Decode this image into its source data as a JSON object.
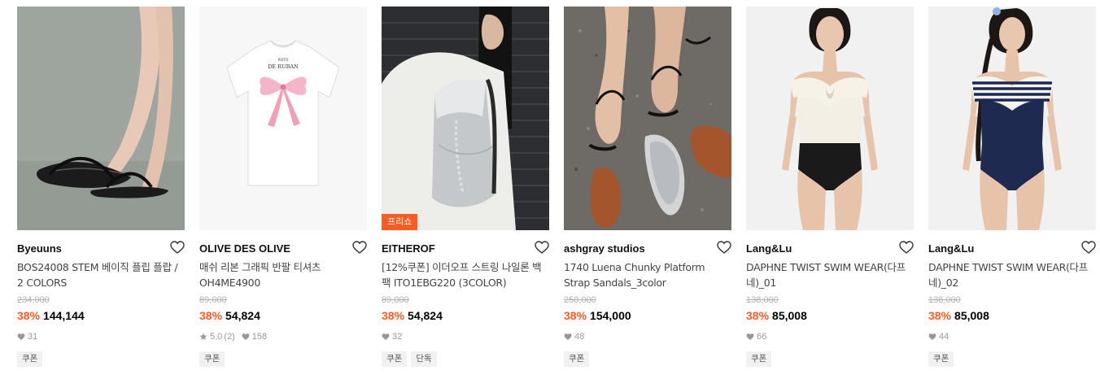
{
  "products": [
    {
      "brand": "Byeuuns",
      "name": "BOS24008 STEM 베이직 플립 플랍 / 2 COLORS",
      "original_price": "234,000",
      "discount": "38%",
      "price": "144,144",
      "rating": "",
      "reviews": "",
      "likes": "31",
      "badge": "",
      "tags": [
        "쿠폰"
      ],
      "image": "black-flip-flop-sandals-on-grey"
    },
    {
      "brand": "OLIVE DES OLIVE",
      "name": "매쉬 리본 그래픽 반팔 티셔츠 OH4ME4900",
      "original_price": "89,000",
      "discount": "38%",
      "price": "54,824",
      "rating": "5.0",
      "reviews": "(2)",
      "likes": "158",
      "badge": "",
      "tags": [
        "쿠폰"
      ],
      "image": "white-tshirt-pink-ribbon",
      "print": "DE RUBAN"
    },
    {
      "brand": "EITHEROF",
      "name": "[12%쿠폰] 이더오프 스트링 나일론 백팩 ITO1EBG220 (3COLOR)",
      "original_price": "89,000",
      "discount": "38%",
      "price": "54,824",
      "rating": "",
      "reviews": "",
      "likes": "32",
      "badge": "프리쇼",
      "tags": [
        "쿠폰",
        "단독"
      ],
      "image": "woman-silver-backpack"
    },
    {
      "brand": "ashgray studios",
      "name": "1740 Luena Chunky Platform Strap Sandals_3color",
      "original_price": "250,000",
      "discount": "38%",
      "price": "154,000",
      "rating": "",
      "reviews": "",
      "likes": "48",
      "badge": "",
      "tags": [
        "쿠폰"
      ],
      "image": "strap-sandals-on-asphalt"
    },
    {
      "brand": "Lang&Lu",
      "name": "DAPHNE TWIST SWIM WEAR(다프네)_01",
      "original_price": "138,000",
      "discount": "38%",
      "price": "85,008",
      "rating": "",
      "reviews": "",
      "likes": "66",
      "badge": "",
      "tags": [
        "쿠폰"
      ],
      "image": "white-black-swimsuit-model"
    },
    {
      "brand": "Lang&Lu",
      "name": "DAPHNE TWIST SWIM WEAR(다프네)_02",
      "original_price": "138,000",
      "discount": "38%",
      "price": "85,008",
      "rating": "",
      "reviews": "",
      "likes": "44",
      "badge": "",
      "tags": [
        "쿠폰"
      ],
      "image": "striped-navy-swimsuit-model"
    }
  ],
  "colors": {
    "discount": "#ff5a1f",
    "badge": "#ff5a1f",
    "tag_bg": "#f1f1f1"
  },
  "icons": {
    "wishlist": "heart-outline-icon",
    "likes": "heart-filled-icon",
    "rating": "star-icon"
  }
}
